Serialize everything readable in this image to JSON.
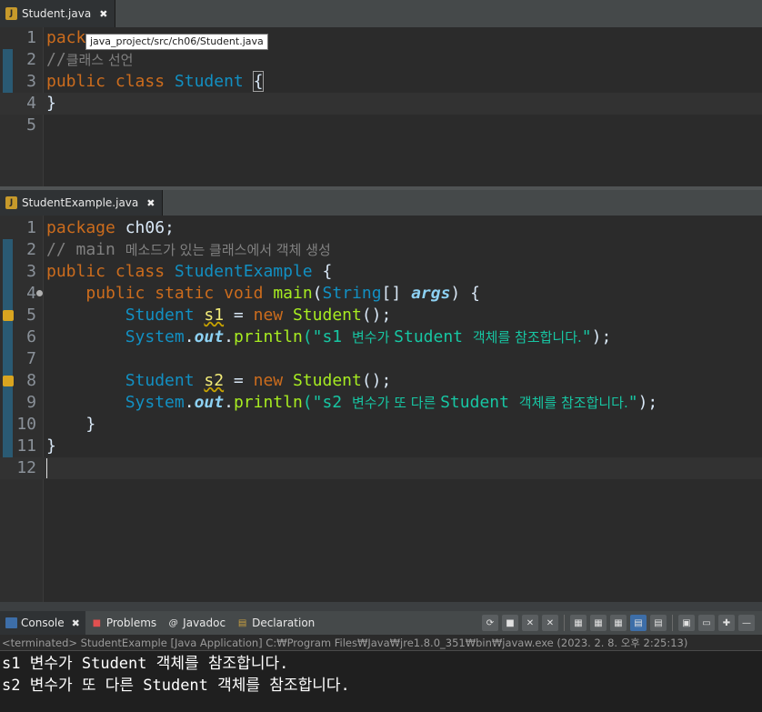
{
  "editor1": {
    "tab_label": "Student.java",
    "tooltip": "java_project/src/ch06/Student.java",
    "lines": [
      {
        "n": "1",
        "parts": [
          {
            "t": "pack",
            "c": "kw"
          }
        ]
      },
      {
        "n": "2",
        "parts": [
          {
            "t": "//",
            "c": "cm"
          },
          {
            "t": "클래스 선언",
            "c": "cm ko"
          }
        ]
      },
      {
        "n": "3",
        "parts": [
          {
            "t": "public",
            "c": "kw"
          },
          {
            "t": " "
          },
          {
            "t": "class",
            "c": "kw"
          },
          {
            "t": " "
          },
          {
            "t": "Student",
            "c": "ty"
          },
          {
            "t": " "
          },
          {
            "t": "{",
            "c": "brace-box"
          }
        ]
      },
      {
        "n": "4",
        "parts": [
          {
            "t": "}"
          }
        ]
      },
      {
        "n": "5",
        "parts": []
      }
    ]
  },
  "editor2": {
    "tab_label": "StudentExample.java",
    "lines": [
      {
        "n": "1",
        "parts": [
          {
            "t": "package",
            "c": "kw"
          },
          {
            "t": " ch06;"
          }
        ]
      },
      {
        "n": "2",
        "parts": [
          {
            "t": "// main ",
            "c": "cm"
          },
          {
            "t": "메소드가 있는 클래스에서 객체 생성",
            "c": "cm ko"
          }
        ]
      },
      {
        "n": "3",
        "parts": [
          {
            "t": "public",
            "c": "kw"
          },
          {
            "t": " "
          },
          {
            "t": "class",
            "c": "kw"
          },
          {
            "t": " "
          },
          {
            "t": "StudentExample",
            "c": "ty"
          },
          {
            "t": " {"
          }
        ]
      },
      {
        "n": "4",
        "parts": [
          {
            "t": "    "
          },
          {
            "t": "public",
            "c": "kw"
          },
          {
            "t": " "
          },
          {
            "t": "static",
            "c": "kw"
          },
          {
            "t": " "
          },
          {
            "t": "void",
            "c": "kw"
          },
          {
            "t": " "
          },
          {
            "t": "main",
            "c": "fn"
          },
          {
            "t": "("
          },
          {
            "t": "String",
            "c": "ty"
          },
          {
            "t": "[] "
          },
          {
            "t": "args",
            "c": "static"
          },
          {
            "t": ") {"
          }
        ]
      },
      {
        "n": "5",
        "parts": [
          {
            "t": "        "
          },
          {
            "t": "Student",
            "c": "ty"
          },
          {
            "t": " "
          },
          {
            "t": "s1",
            "c": "var"
          },
          {
            "t": " = "
          },
          {
            "t": "new",
            "c": "kw"
          },
          {
            "t": " "
          },
          {
            "t": "Student",
            "c": "fn"
          },
          {
            "t": "();"
          }
        ]
      },
      {
        "n": "6",
        "parts": [
          {
            "t": "        "
          },
          {
            "t": "System",
            "c": "ty"
          },
          {
            "t": "."
          },
          {
            "t": "out",
            "c": "static"
          },
          {
            "t": "."
          },
          {
            "t": "println",
            "c": "fn"
          },
          {
            "t": "(\"s1 ",
            "c": "str"
          },
          {
            "t": "변수가 ",
            "c": "str ko"
          },
          {
            "t": "Student ",
            "c": "str"
          },
          {
            "t": "객체를 참조합니다.",
            "c": "str ko"
          },
          {
            "t": "\"",
            "c": "str"
          },
          {
            "t": ");"
          }
        ]
      },
      {
        "n": "7",
        "parts": []
      },
      {
        "n": "8",
        "parts": [
          {
            "t": "        "
          },
          {
            "t": "Student",
            "c": "ty"
          },
          {
            "t": " "
          },
          {
            "t": "s2",
            "c": "var"
          },
          {
            "t": " = "
          },
          {
            "t": "new",
            "c": "kw"
          },
          {
            "t": " "
          },
          {
            "t": "Student",
            "c": "fn"
          },
          {
            "t": "();"
          }
        ]
      },
      {
        "n": "9",
        "parts": [
          {
            "t": "        "
          },
          {
            "t": "System",
            "c": "ty"
          },
          {
            "t": "."
          },
          {
            "t": "out",
            "c": "static"
          },
          {
            "t": "."
          },
          {
            "t": "println",
            "c": "fn"
          },
          {
            "t": "(\"s2 ",
            "c": "str"
          },
          {
            "t": "변수가 또 다른 ",
            "c": "str ko"
          },
          {
            "t": "Student ",
            "c": "str"
          },
          {
            "t": "객체를 참조합니다.",
            "c": "str ko"
          },
          {
            "t": "\"",
            "c": "str"
          },
          {
            "t": ");"
          }
        ]
      },
      {
        "n": "10",
        "parts": [
          {
            "t": "    }"
          }
        ]
      },
      {
        "n": "11",
        "parts": [
          {
            "t": "}"
          }
        ]
      },
      {
        "n": "12",
        "parts": []
      }
    ]
  },
  "console": {
    "tabs": [
      {
        "label": "Console",
        "icon": "console-icon",
        "closable": true
      },
      {
        "label": "Problems",
        "icon": "problems-icon"
      },
      {
        "label": "Javadoc",
        "icon": "javadoc-icon"
      },
      {
        "label": "Declaration",
        "icon": "declaration-icon"
      }
    ],
    "terminated": "<terminated> StudentExample [Java Application] C:₩Program Files₩Java₩jre1.8.0_351₩bin₩javaw.exe (2023. 2. 8. 오후 2:25:13)",
    "output": [
      "s1 변수가 Student 객체를 참조합니다.",
      "s2 변수가 또 다른 Student 객체를 참조합니다."
    ]
  },
  "colors": {
    "keyword": "#cc6c1d",
    "type": "#1290c3",
    "string": "#17c6a3",
    "method": "#a7ec21",
    "comment": "#808080",
    "variable": "#f3ec79"
  }
}
